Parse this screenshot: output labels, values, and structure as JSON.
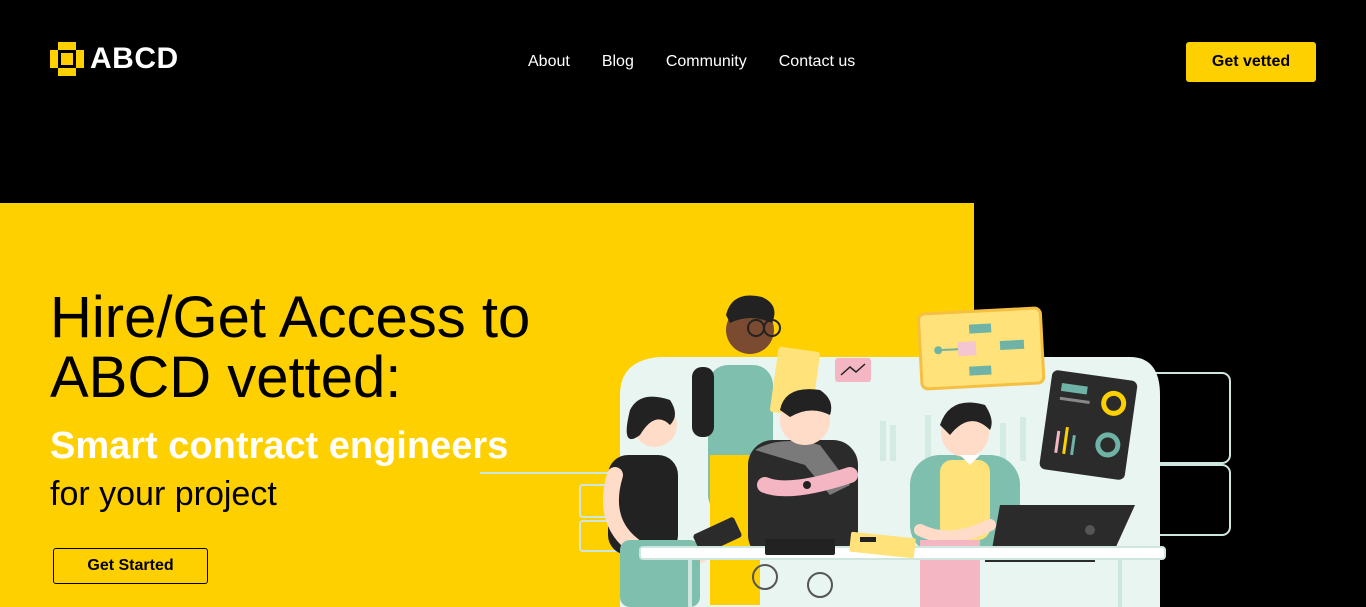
{
  "brand": {
    "name": "ABCD",
    "accent": "#ffd000",
    "background": "#000000"
  },
  "nav": {
    "items": [
      {
        "label": "About"
      },
      {
        "label": "Blog"
      },
      {
        "label": "Community"
      },
      {
        "label": "Contact us"
      }
    ]
  },
  "header": {
    "cta_label": "Get vetted"
  },
  "hero": {
    "title": "Hire/Get Access to ABCD vetted:",
    "subtitle": "Smart contract engineers",
    "tagline": "for your project",
    "cta_label": "Get Started",
    "illustration": "team-collaboration-illustration"
  }
}
